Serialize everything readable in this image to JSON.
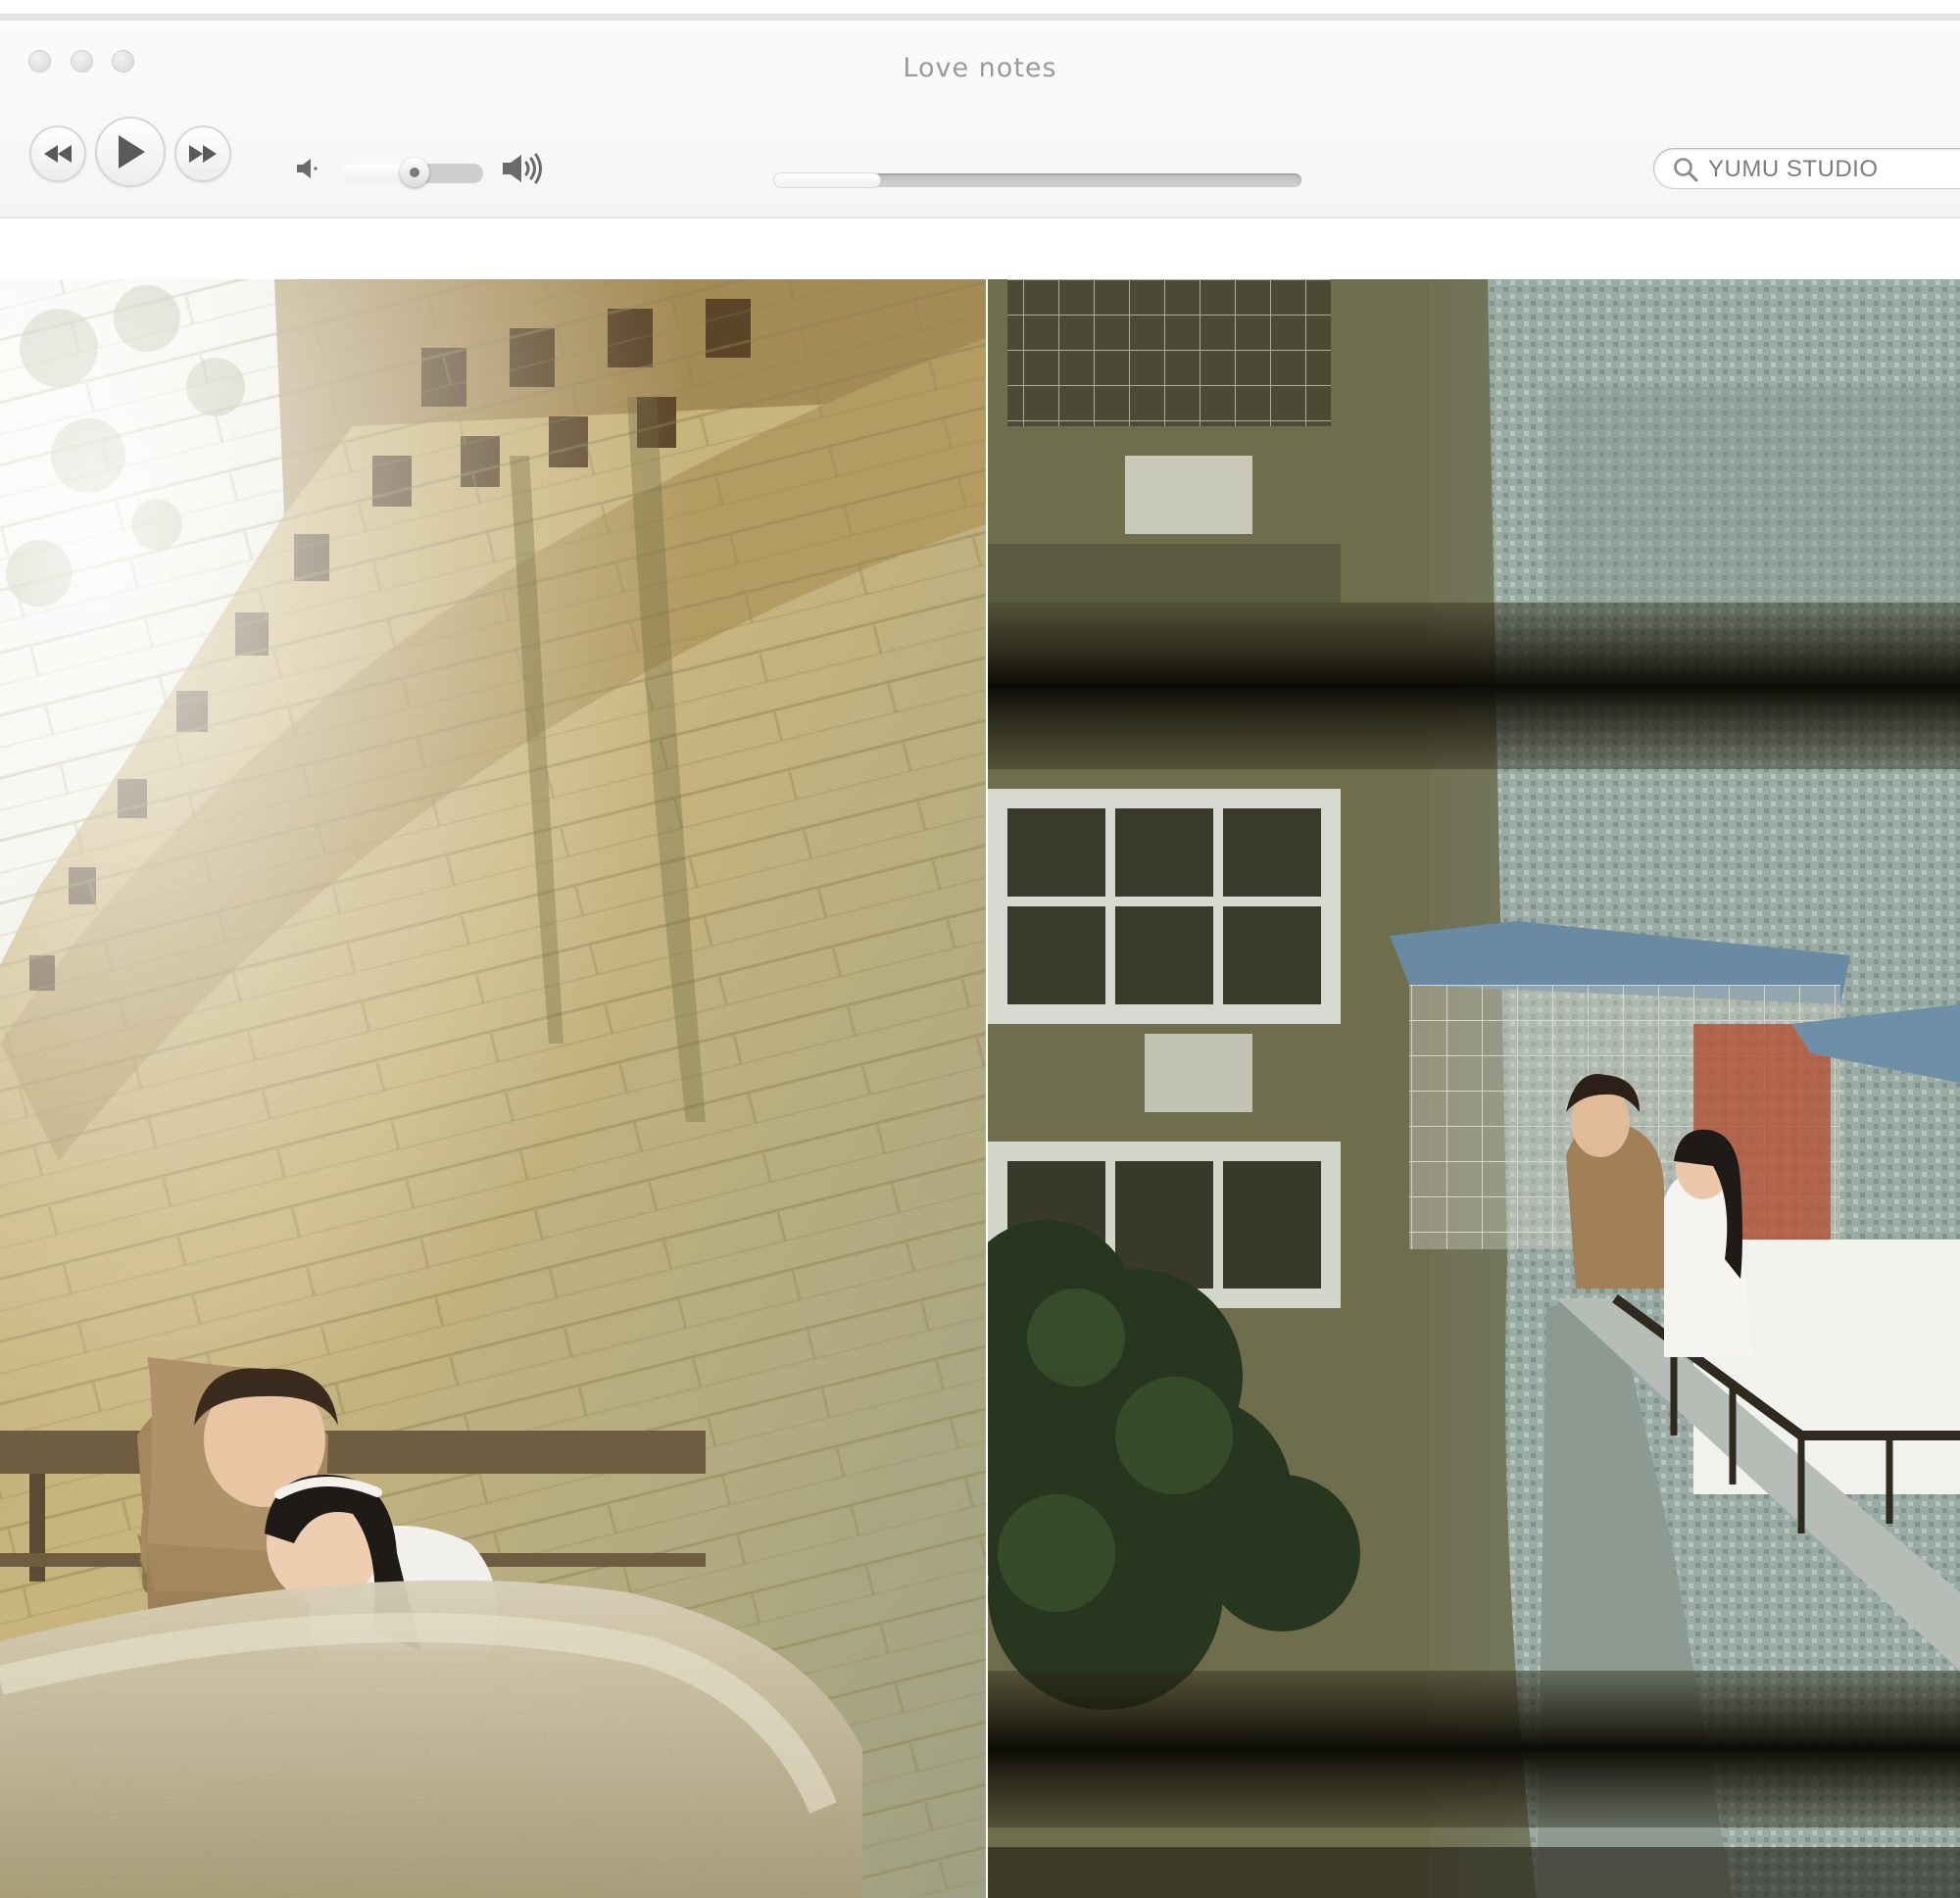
{
  "window": {
    "title": "Love notes",
    "traffic_lights": [
      "close",
      "minimize",
      "zoom"
    ]
  },
  "player": {
    "controls": [
      {
        "name": "rewind",
        "icon": "rewind-icon"
      },
      {
        "name": "play",
        "icon": "play-icon"
      },
      {
        "name": "fast-forward",
        "icon": "fast-forward-icon"
      }
    ],
    "volume": {
      "level": 0.52,
      "low_icon": "speaker-low-icon",
      "high_icon": "speaker-high-icon"
    },
    "progress": 0.2
  },
  "search": {
    "value": "YUMU STUDIO",
    "icon": "search-icon"
  },
  "photos": [
    {
      "name": "couple-embracing-by-curved-brick-wall",
      "dominant_colors": [
        "#c9b57a",
        "#a89a63",
        "#8d8a6a"
      ]
    },
    {
      "name": "couple-on-mosaic-balcony-framed-by-railings",
      "dominant_colors": [
        "#5f6a4e",
        "#8fa1a0",
        "#2a2a1a"
      ]
    }
  ]
}
